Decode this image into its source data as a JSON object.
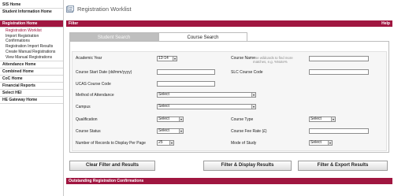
{
  "sidebar": {
    "items": [
      {
        "label": "SIS Home"
      },
      {
        "label": "Student Information Home"
      },
      {
        "label": "Registration Home"
      },
      {
        "label": "Attendance Home"
      },
      {
        "label": "Combined Home"
      },
      {
        "label": "CoC Home"
      },
      {
        "label": "Financial Reports"
      },
      {
        "label": "Select HEI"
      },
      {
        "label": "HE Gateway Home"
      }
    ],
    "subitems": [
      {
        "label": "Registration Worklist"
      },
      {
        "label": "Import Registration Confirmations"
      },
      {
        "label": "Registration Import Results"
      },
      {
        "label": "Create Manual Registrations"
      },
      {
        "label": "View Manual Registrations"
      }
    ]
  },
  "header": {
    "title": "Registration Worklist"
  },
  "filter_bar": {
    "title": "Filter",
    "help": "Help"
  },
  "tabs": [
    {
      "label": "Student Search",
      "active": false
    },
    {
      "label": "Course Search",
      "active": true
    }
  ],
  "form": {
    "academic_year": {
      "label": "Academic Year",
      "value": "13-14"
    },
    "course_name": {
      "label": "Course Name",
      "hint": "Use wildcards to find more matches, e.g. %Note%",
      "value": ""
    },
    "course_start_date": {
      "label": "Course Start Date (dd/mm/yyyy)",
      "value": ""
    },
    "slc_course_code": {
      "label": "SLC Course Code",
      "value": ""
    },
    "ucas_course_code": {
      "label": "UCAS Course Code",
      "value": ""
    },
    "method_of_attendance": {
      "label": "Method of Attendance",
      "value": "Select"
    },
    "campus": {
      "label": "Campus",
      "value": "Select"
    },
    "qualification": {
      "label": "Qualification",
      "value": "Select"
    },
    "course_type": {
      "label": "Course Type",
      "value": "Select"
    },
    "course_status": {
      "label": "Course Status",
      "value": "Select"
    },
    "course_fee_rate": {
      "label": "Course Fee Rate (£)",
      "value": ""
    },
    "records_per_page": {
      "label": "Number of Records to Display Per Page",
      "value": "25"
    },
    "mode_of_study": {
      "label": "Mode of Study",
      "value": "Select"
    }
  },
  "buttons": {
    "clear": "Clear Filter and Results",
    "display": "Filter & Display Results",
    "export": "Filter & Export Results"
  },
  "outstanding": {
    "title": "Outstanding Registration Confirmations"
  },
  "colors": {
    "accent": "#a01640"
  }
}
